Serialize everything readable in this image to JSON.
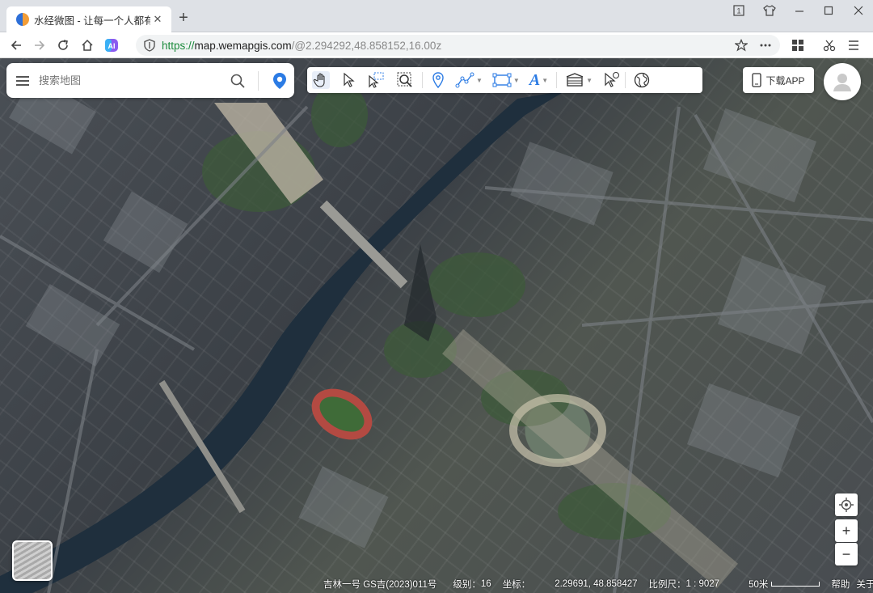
{
  "browser": {
    "tab_title": "水经微图 - 让每一个人都有自",
    "tab_close": "✕",
    "new_tab": "+",
    "url_protocol": "https://",
    "url_host": "map.wemapgis.com",
    "url_rest": "/@2.294292,48.858152,16.00z"
  },
  "map": {
    "search_placeholder": "搜索地图",
    "download_label": "下载APP",
    "zoom_in": "+",
    "zoom_out": "−",
    "text_tool": "A"
  },
  "statusbar": {
    "copyright": "吉林一号 GS吉(2023)011号",
    "level_label": "级别：",
    "level_value": "16",
    "coord_label": "坐标：",
    "coord_value": "2.29691, 48.858427",
    "scale_label": "比例尺：",
    "scale_value": "1 : 9027",
    "scalebar_label": "50米",
    "help": "帮助",
    "about": "关于"
  },
  "colors": {
    "accent": "#2b7be4",
    "url_green": "#1a8a3b"
  }
}
